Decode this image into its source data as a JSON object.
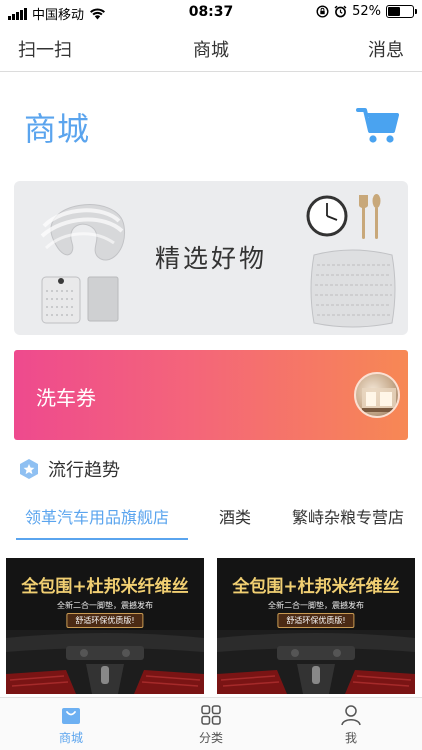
{
  "status_bar": {
    "carrier": "中国移动",
    "time": "08:37",
    "battery": "52%",
    "battery_level": 0.52
  },
  "nav": {
    "left": "扫一扫",
    "title": "商城",
    "right": "消息"
  },
  "header": {
    "title": "商城",
    "cart_icon": "cart-icon"
  },
  "banner": {
    "text": "精选好物"
  },
  "coupon": {
    "label": "洗车券"
  },
  "trend": {
    "label": "流行趋势",
    "icon": "star-hexagon-icon"
  },
  "tabs": [
    {
      "label": "领革汽车用品旗舰店",
      "active": true
    },
    {
      "label": "酒类",
      "active": false
    },
    {
      "label": "繁峙杂粮专营店",
      "active": false
    }
  ],
  "products": [
    {
      "headline": "全包围+杜邦米纤维丝",
      "subline": "全新二合一脚垫，震撼发布",
      "tag": "舒适环保优质版!"
    },
    {
      "headline": "全包围+杜邦米纤维丝",
      "subline": "全新二合一脚垫，震撼发布",
      "tag": "舒适环保优质版!"
    }
  ],
  "tabbar": [
    {
      "label": "商城",
      "icon": "bag-icon",
      "active": true
    },
    {
      "label": "分类",
      "icon": "grid-icon",
      "active": false
    },
    {
      "label": "我",
      "icon": "person-icon",
      "active": false
    }
  ],
  "colors": {
    "accent": "#5aa4ee",
    "coupon_start": "#ee4a8e",
    "coupon_end": "#f78854",
    "product_gold": "#f1cf72"
  }
}
